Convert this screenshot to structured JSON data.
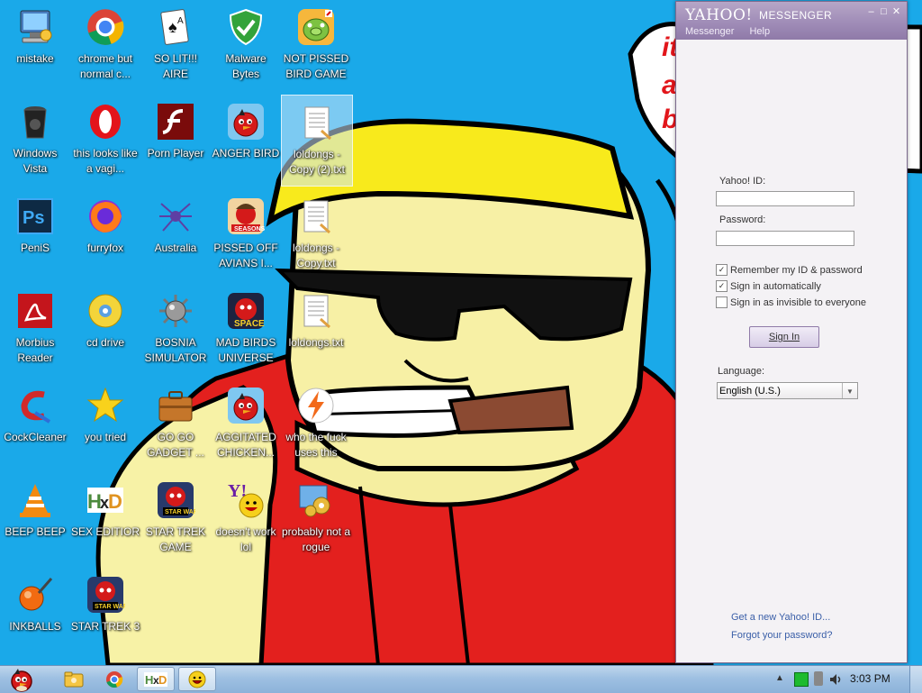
{
  "desktop": {
    "icons": [
      {
        "label": "mistake",
        "icon": "computer-icon"
      },
      {
        "label": "chrome but normal c...",
        "icon": "chrome-icon"
      },
      {
        "label": "SO LIT!!! AIRE",
        "icon": "solitaire-icon"
      },
      {
        "label": "Malware Bytes",
        "icon": "shield-icon"
      },
      {
        "label": "NOT PISSED BIRD GAME",
        "icon": "green-pig-icon"
      },
      {
        "label": "Windows Vista",
        "icon": "recycle-bin-icon"
      },
      {
        "label": "this looks like a vagi...",
        "icon": "opera-icon"
      },
      {
        "label": "Porn Player",
        "icon": "flash-icon"
      },
      {
        "label": "ANGER BIRD",
        "icon": "angry-bird-icon"
      },
      {
        "label": "loldongs - Copy (2).txt",
        "icon": "text-file-icon"
      },
      {
        "label": "PeniS",
        "icon": "photoshop-icon"
      },
      {
        "label": "furryfox",
        "icon": "firefox-icon"
      },
      {
        "label": "Australia",
        "icon": "spider-solitaire-icon"
      },
      {
        "label": "PISSED OFF AVIANS I...",
        "icon": "angry-birds-seasons-icon"
      },
      {
        "label": "loldongs - Copy.txt",
        "icon": "text-file-icon"
      },
      {
        "label": "Morbius Reader",
        "icon": "pdf-reader-icon"
      },
      {
        "label": "cd drive",
        "icon": "cd-icon"
      },
      {
        "label": "BOSNIA SIMULATOR",
        "icon": "mine-icon"
      },
      {
        "label": "MAD BIRDS UNIVERSE",
        "icon": "angry-birds-space-icon"
      },
      {
        "label": "loldongs.txt",
        "icon": "text-file-icon"
      },
      {
        "label": "CockCleaner",
        "icon": "ccleaner-icon"
      },
      {
        "label": "you tried",
        "icon": "star-icon"
      },
      {
        "label": "GO GO GADGET ...",
        "icon": "briefcase-icon"
      },
      {
        "label": "AGGITATED CHICKEN...",
        "icon": "angry-bird-icon"
      },
      {
        "label": "who the fuck uses this",
        "icon": "lightning-icon"
      },
      {
        "label": "BEEP BEEP",
        "icon": "vlc-icon"
      },
      {
        "label": "SEX EDITIOR",
        "icon": "hxd-icon"
      },
      {
        "label": "STAR TREK GAME",
        "icon": "angry-birds-star-wars-icon"
      },
      {
        "label": "doesn't work lol",
        "icon": "yahoo-messenger-icon"
      },
      {
        "label": "probably not a rogue",
        "icon": "control-panel-icon"
      },
      {
        "label": "INKBALLS",
        "icon": "inkball-icon"
      },
      {
        "label": "STAR TREK 3",
        "icon": "angry-birds-star-wars-icon"
      }
    ]
  },
  "wallpaper": {
    "speech_bubble_text": [
      "it",
      "a",
      "b"
    ]
  },
  "yahoo_messenger": {
    "logo": "YAHOO!",
    "logo_sub": "MESSENGER",
    "menu": [
      "Messenger",
      "Help"
    ],
    "yahoo_id_label": "Yahoo! ID:",
    "yahoo_id_value": "",
    "password_label": "Password:",
    "password_value": "",
    "remember_label": "Remember my ID & password",
    "remember_checked": true,
    "auto_signin_label": "Sign in automatically",
    "auto_signin_checked": true,
    "invisible_label": "Sign in as invisible to everyone",
    "invisible_checked": false,
    "signin_button": "Sign In",
    "language_label": "Language:",
    "language_value": "English (U.S.)",
    "new_id_link": "Get a new Yahoo! ID...",
    "forgot_link": "Forgot your password?"
  },
  "taskbar": {
    "items": [
      "start-button",
      "explorer",
      "chrome",
      "hxd",
      "yahoo-messenger"
    ],
    "time": "3:03 PM"
  },
  "colors": {
    "desktop_bg": "#1aa9e9",
    "yahoo_purple": "#9e8ab6",
    "link_blue": "#3a5fa8"
  }
}
